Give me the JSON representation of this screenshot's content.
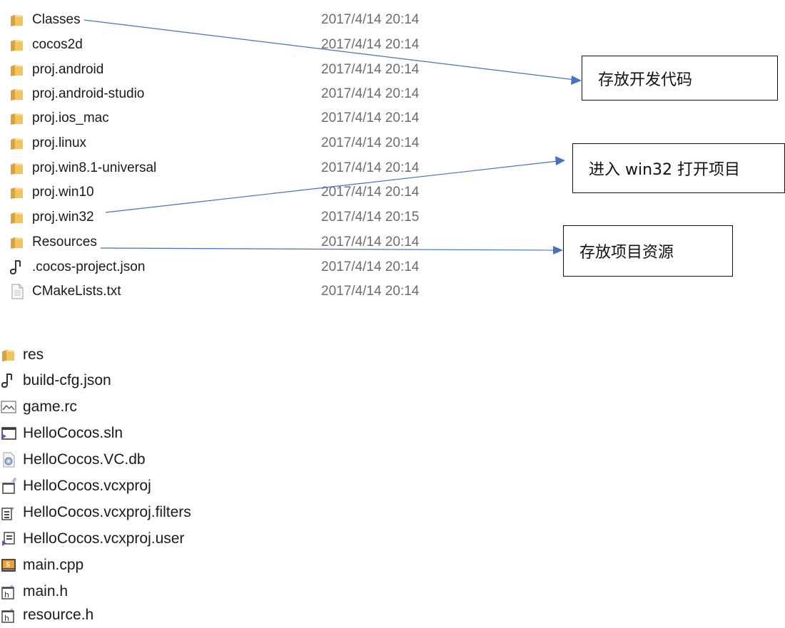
{
  "upper_list": {
    "items": [
      {
        "name": "Classes",
        "date": "2017/4/14 20:14",
        "icon": "folder-icon"
      },
      {
        "name": "cocos2d",
        "date": "2017/4/14 20:14",
        "icon": "folder-icon"
      },
      {
        "name": "proj.android",
        "date": "2017/4/14 20:14",
        "icon": "folder-icon"
      },
      {
        "name": "proj.android-studio",
        "date": "2017/4/14 20:14",
        "icon": "folder-icon"
      },
      {
        "name": "proj.ios_mac",
        "date": "2017/4/14 20:14",
        "icon": "folder-icon"
      },
      {
        "name": "proj.linux",
        "date": "2017/4/14 20:14",
        "icon": "folder-icon"
      },
      {
        "name": "proj.win8.1-universal",
        "date": "2017/4/14 20:14",
        "icon": "folder-icon"
      },
      {
        "name": "proj.win10",
        "date": "2017/4/14 20:14",
        "icon": "folder-icon"
      },
      {
        "name": "proj.win32",
        "date": "2017/4/14 20:15",
        "icon": "folder-icon"
      },
      {
        "name": "Resources",
        "date": "2017/4/14 20:14",
        "icon": "folder-icon"
      },
      {
        "name": ".cocos-project.json",
        "date": "2017/4/14 20:14",
        "icon": "json-file-icon"
      },
      {
        "name": "CMakeLists.txt",
        "date": "2017/4/14 20:14",
        "icon": "text-file-icon"
      }
    ]
  },
  "callouts": {
    "classes": "存放开发代码",
    "win32": "进入 win32 打开项目",
    "resources": "存放项目资源"
  },
  "lower_list": {
    "items": [
      {
        "name": "res",
        "icon": "folder-icon"
      },
      {
        "name": "build-cfg.json",
        "icon": "json-file-icon"
      },
      {
        "name": "game.rc",
        "icon": "resource-script-icon"
      },
      {
        "name": "HelloCocos.sln",
        "icon": "visual-studio-solution-icon"
      },
      {
        "name": "HelloCocos.VC.db",
        "icon": "database-file-icon"
      },
      {
        "name": "HelloCocos.vcxproj",
        "icon": "vcxproj-file-icon"
      },
      {
        "name": "HelloCocos.vcxproj.filters",
        "icon": "filters-file-icon"
      },
      {
        "name": "HelloCocos.vcxproj.user",
        "icon": "user-file-icon"
      },
      {
        "name": "main.cpp",
        "icon": "cpp-file-icon"
      },
      {
        "name": "main.h",
        "icon": "header-file-icon"
      },
      {
        "name": "resource.h",
        "icon": "header-file-icon"
      }
    ]
  },
  "colors": {
    "arrow": "#4472c4",
    "folder": "#f2c45a",
    "date_text": "#6d6d6d"
  }
}
